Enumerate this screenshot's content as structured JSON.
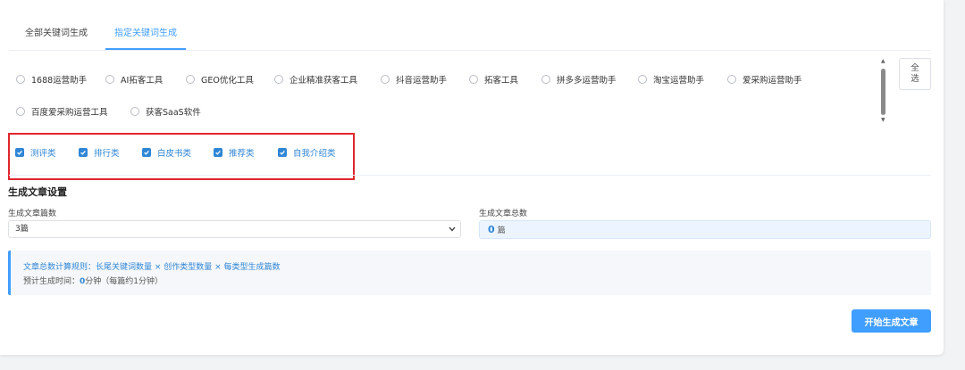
{
  "tabs": [
    {
      "label": "全部关键词生成",
      "active": false
    },
    {
      "label": "指定关键词生成",
      "active": true
    }
  ],
  "products": [
    "1688运营助手",
    "AI拓客工具",
    "GEO优化工具",
    "企业精准获客工具",
    "抖音运营助手",
    "拓客工具",
    "拼多多运营助手",
    "淘宝运营助手",
    "爱采购运营助手",
    "百度爱采购运营工具",
    "获客SaaS软件"
  ],
  "select_all_label": "全选",
  "categories": [
    {
      "label": "测评类",
      "checked": true
    },
    {
      "label": "排行类",
      "checked": true
    },
    {
      "label": "白皮书类",
      "checked": true
    },
    {
      "label": "推荐类",
      "checked": true
    },
    {
      "label": "自我介绍类",
      "checked": true
    }
  ],
  "settings": {
    "title": "生成文章设置",
    "count_label": "生成文章篇数",
    "count_value": "3篇",
    "total_label": "生成文章总数",
    "total_value": "0",
    "total_unit": "篇"
  },
  "info": {
    "rule": "文章总数计算规则：长尾关键词数量 × 创作类型数量 × 每类型生成篇数",
    "time_prefix": "预计生成时间：",
    "time_value": "0",
    "time_suffix": "分钟（每篇约1分钟）"
  },
  "start_button": "开始生成文章",
  "colors": {
    "accent": "#409eff",
    "highlight_box": "#e0262d"
  }
}
